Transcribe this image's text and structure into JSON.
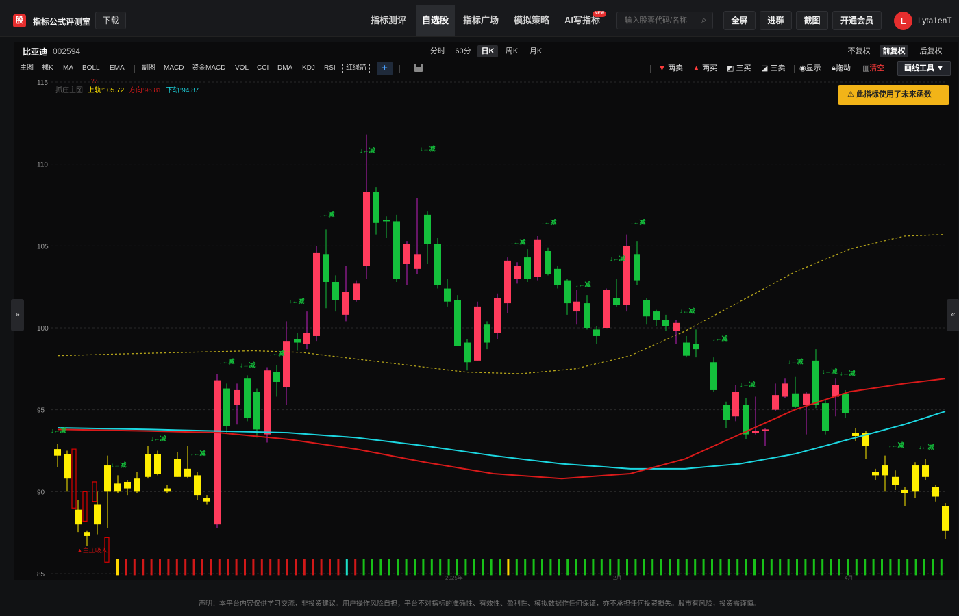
{
  "header": {
    "logo_glyph": "股",
    "app_title": "指标公式评测室",
    "download_label": "下载",
    "nav": [
      {
        "label": "指标测评",
        "active": false
      },
      {
        "label": "自选股",
        "active": true
      },
      {
        "label": "指标广场",
        "active": false
      },
      {
        "label": "模拟策略",
        "active": false
      },
      {
        "label": "AI写指标",
        "active": false
      }
    ],
    "new_badge": "NEW",
    "search_placeholder": "输入股票代码/名称",
    "buttons": [
      "全屏",
      "进群",
      "截图",
      "开通会员"
    ],
    "avatar_letter": "L",
    "username": "Lyta1enT"
  },
  "stock": {
    "name": "比亚迪",
    "code": "002594"
  },
  "periods": [
    {
      "label": "分时",
      "active": false
    },
    {
      "label": "60分",
      "active": false
    },
    {
      "label": "日K",
      "active": true
    },
    {
      "label": "周K",
      "active": false
    },
    {
      "label": "月K",
      "active": false
    }
  ],
  "adjust": [
    {
      "label": "不复权",
      "active": false
    },
    {
      "label": "前复权",
      "active": true
    },
    {
      "label": "后复权",
      "active": false
    }
  ],
  "indicators_main": [
    "主图",
    "裸K",
    "MA",
    "BOLL",
    "EMA"
  ],
  "indicators_sub": [
    "副图",
    "MACD",
    "资金MACD",
    "VOL",
    "CCI",
    "DMA",
    "KDJ",
    "RSI"
  ],
  "indicator_boxed": "红绿箭",
  "right_tools": [
    {
      "label": "两卖",
      "icon": "down-triangle-icon",
      "color": "#ff3b3b"
    },
    {
      "label": "两买",
      "icon": "up-triangle-icon",
      "color": "#ff3b3b"
    },
    {
      "label": "三买",
      "icon": "line-chart-icon",
      "color": "#ddd"
    },
    {
      "label": "三卖",
      "icon": "line-chart-icon",
      "color": "#ddd"
    },
    {
      "label": "显示",
      "icon": "eye-icon",
      "color": "#ddd"
    },
    {
      "label": "拖动",
      "icon": "lock-icon",
      "color": "#ddd"
    },
    {
      "label": "清空",
      "icon": "trash-icon",
      "color": "#ff3b3b"
    }
  ],
  "draw_tools_label": "画线工具 ▼",
  "warning": "此指标使用了未来函数",
  "legend": {
    "name": "抓庄主图",
    "upper": "上轨:105.72",
    "mid": "方向:96.81",
    "lower": "下轨:94.87",
    "mark": "??"
  },
  "chart_data": {
    "type": "candlestick",
    "y_ticks": [
      "115",
      "110",
      "105",
      "100",
      "95",
      "90",
      "85"
    ],
    "ylim": [
      85,
      115
    ],
    "signal_label": "▲主庄吸入",
    "arrow_label": "↓←减",
    "x_labels": [
      "2025年",
      "2月",
      "3月",
      "4月"
    ],
    "colors": {
      "up": "#ff3b5c",
      "down": "#14c03c",
      "yellow": "#ffee00",
      "cyan": "#1cd6e0",
      "red": "#d91a1a",
      "olive": "#b7a61a"
    }
  },
  "side_tabs": {
    "left": "»",
    "right": "«"
  },
  "footer": "声明：本平台内容仅供学习交流，非投资建议。用户操作风险自担；平台不对指标的准确性、有效性、盈利性、模拟数据作任何保证，亦不承担任何投资损失。股市有风险，投资需谨慎。"
}
